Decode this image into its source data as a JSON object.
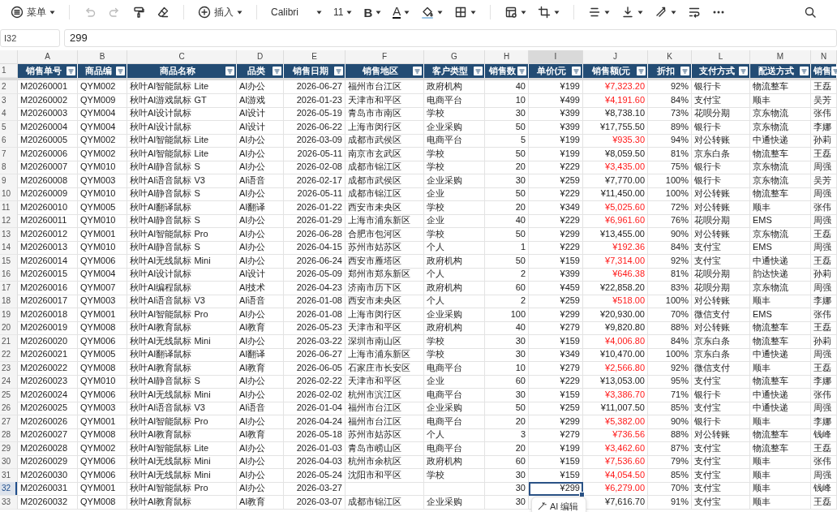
{
  "toolbar": [
    {
      "kind": "menu",
      "label": "菜单",
      "caret": true,
      "disabled": false
    },
    {
      "kind": "separator"
    },
    {
      "kind": "undo",
      "caret": false,
      "disabled": true
    },
    {
      "kind": "redo",
      "caret": false,
      "disabled": true
    },
    {
      "kind": "painter",
      "caret": false,
      "disabled": false
    },
    {
      "kind": "eraser",
      "caret": false,
      "disabled": false
    },
    {
      "kind": "separator"
    },
    {
      "kind": "insert",
      "label": "插入",
      "caret": true,
      "disabled": false
    },
    {
      "kind": "separator"
    },
    {
      "kind": "font",
      "label": "Calibri",
      "caret": true,
      "disabled": false
    },
    {
      "kind": "size",
      "label": "11",
      "caret": true,
      "disabled": false
    },
    {
      "kind": "bold",
      "label": "B",
      "caret": true,
      "disabled": false
    },
    {
      "kind": "font-color",
      "label": "A",
      "caret": true,
      "disabled": false
    },
    {
      "kind": "fill",
      "caret": true,
      "disabled": false
    },
    {
      "kind": "borders",
      "caret": true,
      "disabled": false
    },
    {
      "kind": "separator"
    },
    {
      "kind": "table",
      "caret": true,
      "disabled": false
    },
    {
      "kind": "crop",
      "caret": true,
      "disabled": false
    },
    {
      "kind": "separator"
    },
    {
      "kind": "align",
      "caret": true,
      "disabled": false
    },
    {
      "kind": "valign",
      "caret": true,
      "disabled": false
    },
    {
      "kind": "rotate",
      "caret": true,
      "disabled": false
    },
    {
      "kind": "wrap",
      "caret": false,
      "disabled": false
    },
    {
      "kind": "more",
      "caret": false,
      "disabled": false
    },
    {
      "kind": "search",
      "caret": false,
      "disabled": false
    }
  ],
  "formula_bar": {
    "cell": "I32",
    "value": "299"
  },
  "table": {
    "columns": [
      {
        "letter": "A",
        "selected": false
      },
      {
        "letter": "B",
        "selected": false
      },
      {
        "letter": "C",
        "selected": false
      },
      {
        "letter": "D",
        "selected": false
      },
      {
        "letter": "E",
        "selected": false
      },
      {
        "letter": "F",
        "selected": false
      },
      {
        "letter": "G",
        "selected": false
      },
      {
        "letter": "H",
        "selected": false
      },
      {
        "letter": "I",
        "selected": true
      },
      {
        "letter": "J",
        "selected": false
      },
      {
        "letter": "K",
        "selected": false
      },
      {
        "letter": "L",
        "selected": false
      },
      {
        "letter": "M",
        "selected": false
      },
      {
        "letter": "N",
        "selected": false
      }
    ],
    "header_row": {
      "number": "1",
      "cells": [
        "销售单号",
        "商品编",
        "商品名称",
        "品类",
        "销售日期",
        "销售地区",
        "客户类型",
        "销售数",
        "单价(元",
        "销售额(元",
        "折扣",
        "支付方式",
        "配送方式",
        "销售"
      ]
    },
    "rows": [
      {
        "number": "2",
        "selected": false,
        "alert": true,
        "cells": [
          "M20260001",
          "QYM002",
          "秋叶AI智能鼠标 Lite",
          "AI办公",
          "2026-06-27",
          "福州市台江区",
          "政府机构",
          "40",
          "¥199",
          "¥7,323.20",
          "92%",
          "银行卡",
          "物流整车",
          "王磊"
        ]
      },
      {
        "number": "3",
        "selected": false,
        "alert": true,
        "cells": [
          "M20260002",
          "QYM009",
          "秋叶AI游戏鼠标 GT",
          "AI游戏",
          "2026-01-23",
          "天津市和平区",
          "电商平台",
          "10",
          "¥499",
          "¥4,191.60",
          "84%",
          "支付宝",
          "顺丰",
          "吴芳"
        ]
      },
      {
        "number": "4",
        "selected": false,
        "alert": false,
        "cells": [
          "M20260003",
          "QYM004",
          "秋叶AI设计鼠标",
          "AI设计",
          "2026-05-19",
          "青岛市市南区",
          "学校",
          "30",
          "¥399",
          "¥8,738.10",
          "73%",
          "花呗分期",
          "京东物流",
          "张伟"
        ]
      },
      {
        "number": "5",
        "selected": false,
        "alert": false,
        "cells": [
          "M20260004",
          "QYM004",
          "秋叶AI设计鼠标",
          "AI设计",
          "2026-06-22",
          "上海市闵行区",
          "企业采购",
          "50",
          "¥399",
          "¥17,755.50",
          "89%",
          "银行卡",
          "京东物流",
          "李娜"
        ]
      },
      {
        "number": "6",
        "selected": false,
        "alert": true,
        "cells": [
          "M20260005",
          "QYM002",
          "秋叶AI智能鼠标 Lite",
          "AI办公",
          "2026-03-09",
          "成都市武侯区",
          "电商平台",
          "5",
          "¥199",
          "¥935.30",
          "94%",
          "对公转账",
          "中通快递",
          "孙莉"
        ]
      },
      {
        "number": "7",
        "selected": false,
        "alert": false,
        "cells": [
          "M20260006",
          "QYM002",
          "秋叶AI智能鼠标 Lite",
          "AI办公",
          "2026-05-11",
          "南京市玄武区",
          "学校",
          "50",
          "¥199",
          "¥8,059.50",
          "81%",
          "京东白条",
          "物流整车",
          "王磊"
        ]
      },
      {
        "number": "8",
        "selected": false,
        "alert": true,
        "cells": [
          "M20260007",
          "QYM010",
          "秋叶AI静音鼠标 S",
          "AI办公",
          "2026-02-08",
          "成都市锦江区",
          "学校",
          "20",
          "¥229",
          "¥3,435.00",
          "75%",
          "银行卡",
          "京东物流",
          "周强"
        ]
      },
      {
        "number": "9",
        "selected": false,
        "alert": false,
        "cells": [
          "M20260008",
          "QYM003",
          "秋叶AI语音鼠标 V3",
          "AI语音",
          "2026-02-17",
          "成都市武侯区",
          "企业采购",
          "30",
          "¥259",
          "¥7,770.00",
          "100%",
          "银行卡",
          "京东物流",
          "吴芳"
        ]
      },
      {
        "number": "10",
        "selected": false,
        "alert": false,
        "cells": [
          "M20260009",
          "QYM010",
          "秋叶AI静音鼠标 S",
          "AI办公",
          "2026-05-11",
          "成都市锦江区",
          "企业",
          "50",
          "¥229",
          "¥11,450.00",
          "100%",
          "对公转账",
          "物流整车",
          "周强"
        ]
      },
      {
        "number": "11",
        "selected": false,
        "alert": true,
        "cells": [
          "M20260010",
          "QYM005",
          "秋叶AI翻译鼠标",
          "AI翻译",
          "2026-01-22",
          "西安市未央区",
          "学校",
          "20",
          "¥349",
          "¥5,025.60",
          "72%",
          "对公转账",
          "顺丰",
          "张伟"
        ]
      },
      {
        "number": "12",
        "selected": false,
        "alert": true,
        "cells": [
          "M20260011",
          "QYM010",
          "秋叶AI静音鼠标 S",
          "AI办公",
          "2026-01-29",
          "上海市浦东新区",
          "企业",
          "40",
          "¥229",
          "¥6,961.60",
          "76%",
          "花呗分期",
          "EMS",
          "周强"
        ]
      },
      {
        "number": "13",
        "selected": false,
        "alert": false,
        "cells": [
          "M20260012",
          "QYM001",
          "秋叶AI智能鼠标 Pro",
          "AI办公",
          "2026-06-28",
          "合肥市包河区",
          "学校",
          "50",
          "¥299",
          "¥13,455.00",
          "90%",
          "对公转账",
          "京东物流",
          "王磊"
        ]
      },
      {
        "number": "14",
        "selected": false,
        "alert": true,
        "cells": [
          "M20260013",
          "QYM010",
          "秋叶AI静音鼠标 S",
          "AI办公",
          "2026-04-15",
          "苏州市姑苏区",
          "个人",
          "1",
          "¥229",
          "¥192.36",
          "84%",
          "支付宝",
          "EMS",
          "周强"
        ]
      },
      {
        "number": "15",
        "selected": false,
        "alert": true,
        "cells": [
          "M20260014",
          "QYM006",
          "秋叶AI无线鼠标 Mini",
          "AI办公",
          "2026-06-24",
          "西安市雁塔区",
          "政府机构",
          "50",
          "¥159",
          "¥7,314.00",
          "92%",
          "支付宝",
          "中通快递",
          "王磊"
        ]
      },
      {
        "number": "16",
        "selected": false,
        "alert": true,
        "cells": [
          "M20260015",
          "QYM004",
          "秋叶AI设计鼠标",
          "AI设计",
          "2026-05-09",
          "郑州市郑东新区",
          "个人",
          "2",
          "¥399",
          "¥646.38",
          "81%",
          "花呗分期",
          "韵达快递",
          "孙莉"
        ]
      },
      {
        "number": "17",
        "selected": false,
        "alert": false,
        "cells": [
          "M20260016",
          "QYM007",
          "秋叶AI编程鼠标",
          "AI技术",
          "2026-04-23",
          "济南市历下区",
          "政府机构",
          "60",
          "¥459",
          "¥22,858.20",
          "83%",
          "花呗分期",
          "京东物流",
          "周强"
        ]
      },
      {
        "number": "18",
        "selected": false,
        "alert": true,
        "cells": [
          "M20260017",
          "QYM003",
          "秋叶AI语音鼠标 V3",
          "AI语音",
          "2026-01-08",
          "西安市未央区",
          "个人",
          "2",
          "¥259",
          "¥518.00",
          "100%",
          "对公转账",
          "顺丰",
          "李娜"
        ]
      },
      {
        "number": "19",
        "selected": false,
        "alert": false,
        "cells": [
          "M20260018",
          "QYM001",
          "秋叶AI智能鼠标 Pro",
          "AI办公",
          "2026-01-08",
          "上海市闵行区",
          "企业采购",
          "100",
          "¥299",
          "¥20,930.00",
          "70%",
          "微信支付",
          "EMS",
          "张伟"
        ]
      },
      {
        "number": "20",
        "selected": false,
        "alert": false,
        "cells": [
          "M20260019",
          "QYM008",
          "秋叶AI教育鼠标",
          "AI教育",
          "2026-05-23",
          "天津市和平区",
          "政府机构",
          "40",
          "¥279",
          "¥9,820.80",
          "88%",
          "对公转账",
          "物流整车",
          "王磊"
        ]
      },
      {
        "number": "21",
        "selected": false,
        "alert": true,
        "cells": [
          "M20260020",
          "QYM006",
          "秋叶AI无线鼠标 Mini",
          "AI办公",
          "2026-03-22",
          "深圳市南山区",
          "学校",
          "30",
          "¥159",
          "¥4,006.80",
          "84%",
          "京东白条",
          "物流整车",
          "孙莉"
        ]
      },
      {
        "number": "22",
        "selected": false,
        "alert": false,
        "cells": [
          "M20260021",
          "QYM005",
          "秋叶AI翻译鼠标",
          "AI翻译",
          "2026-06-27",
          "上海市浦东新区",
          "学校",
          "30",
          "¥349",
          "¥10,470.00",
          "100%",
          "京东白条",
          "中通快递",
          "周强"
        ]
      },
      {
        "number": "23",
        "selected": false,
        "alert": true,
        "cells": [
          "M20260022",
          "QYM008",
          "秋叶AI教育鼠标",
          "AI教育",
          "2026-06-05",
          "石家庄市长安区",
          "电商平台",
          "10",
          "¥279",
          "¥2,566.80",
          "92%",
          "微信支付",
          "顺丰",
          "王磊"
        ]
      },
      {
        "number": "24",
        "selected": false,
        "alert": false,
        "cells": [
          "M20260023",
          "QYM010",
          "秋叶AI静音鼠标 S",
          "AI办公",
          "2026-02-22",
          "天津市和平区",
          "企业",
          "60",
          "¥229",
          "¥13,053.00",
          "95%",
          "支付宝",
          "物流整车",
          "李娜"
        ]
      },
      {
        "number": "25",
        "selected": false,
        "alert": true,
        "cells": [
          "M20260024",
          "QYM006",
          "秋叶AI无线鼠标 Mini",
          "AI办公",
          "2026-02-02",
          "杭州市滨江区",
          "电商平台",
          "30",
          "¥159",
          "¥3,386.70",
          "71%",
          "银行卡",
          "中通快递",
          "张伟"
        ]
      },
      {
        "number": "26",
        "selected": false,
        "alert": false,
        "cells": [
          "M20260025",
          "QYM003",
          "秋叶AI语音鼠标 V3",
          "AI语音",
          "2026-01-04",
          "福州市台江区",
          "企业采购",
          "50",
          "¥259",
          "¥11,007.50",
          "85%",
          "支付宝",
          "中通快递",
          "周强"
        ]
      },
      {
        "number": "27",
        "selected": false,
        "alert": true,
        "cells": [
          "M20260026",
          "QYM001",
          "秋叶AI智能鼠标 Pro",
          "AI办公",
          "2026-04-24",
          "福州市台江区",
          "电商平台",
          "20",
          "¥299",
          "¥5,382.00",
          "90%",
          "银行卡",
          "顺丰",
          "李娜"
        ]
      },
      {
        "number": "28",
        "selected": false,
        "alert": true,
        "cells": [
          "M20260027",
          "QYM008",
          "秋叶AI教育鼠标",
          "AI教育",
          "2026-05-18",
          "苏州市姑苏区",
          "个人",
          "3",
          "¥279",
          "¥736.56",
          "88%",
          "对公转账",
          "物流整车",
          "钱峰"
        ]
      },
      {
        "number": "29",
        "selected": false,
        "alert": true,
        "cells": [
          "M20260028",
          "QYM002",
          "秋叶AI智能鼠标 Lite",
          "AI办公",
          "2026-01-03",
          "青岛市崂山区",
          "电商平台",
          "20",
          "¥199",
          "¥3,462.60",
          "87%",
          "支付宝",
          "物流整车",
          "王磊"
        ]
      },
      {
        "number": "30",
        "selected": false,
        "alert": true,
        "cells": [
          "M20260029",
          "QYM006",
          "秋叶AI无线鼠标 Mini",
          "AI办公",
          "2026-04-03",
          "杭州市余杭区",
          "政府机构",
          "60",
          "¥159",
          "¥7,536.60",
          "79%",
          "支付宝",
          "顺丰",
          "张伟"
        ]
      },
      {
        "number": "31",
        "selected": false,
        "alert": true,
        "cells": [
          "M20260030",
          "QYM006",
          "秋叶AI无线鼠标 Mini",
          "AI办公",
          "2026-05-24",
          "沈阳市和平区",
          "学校",
          "30",
          "¥159",
          "¥4,054.50",
          "85%",
          "支付宝",
          "顺丰",
          "周强"
        ]
      },
      {
        "number": "32",
        "selected": true,
        "alert": true,
        "cells": [
          "M20260031",
          "QYM001",
          "秋叶AI智能鼠标 Pro",
          "AI办公",
          "2026-03-27",
          null,
          null,
          "30",
          "¥299",
          "¥6,279.00",
          "70%",
          "支付宝",
          "顺丰",
          "钱峰"
        ]
      },
      {
        "number": "33",
        "selected": false,
        "alert": false,
        "cells": [
          "M20260032",
          "QYM008",
          "秋叶AI教育鼠标",
          "AI教育",
          "2026-03-07",
          "成都市锦江区",
          "企业采购",
          "30",
          null,
          "¥7,616.70",
          "91%",
          "支付宝",
          "顺丰",
          "王磊"
        ]
      }
    ]
  },
  "ai_edit_button": {
    "label": "AI 编辑"
  }
}
